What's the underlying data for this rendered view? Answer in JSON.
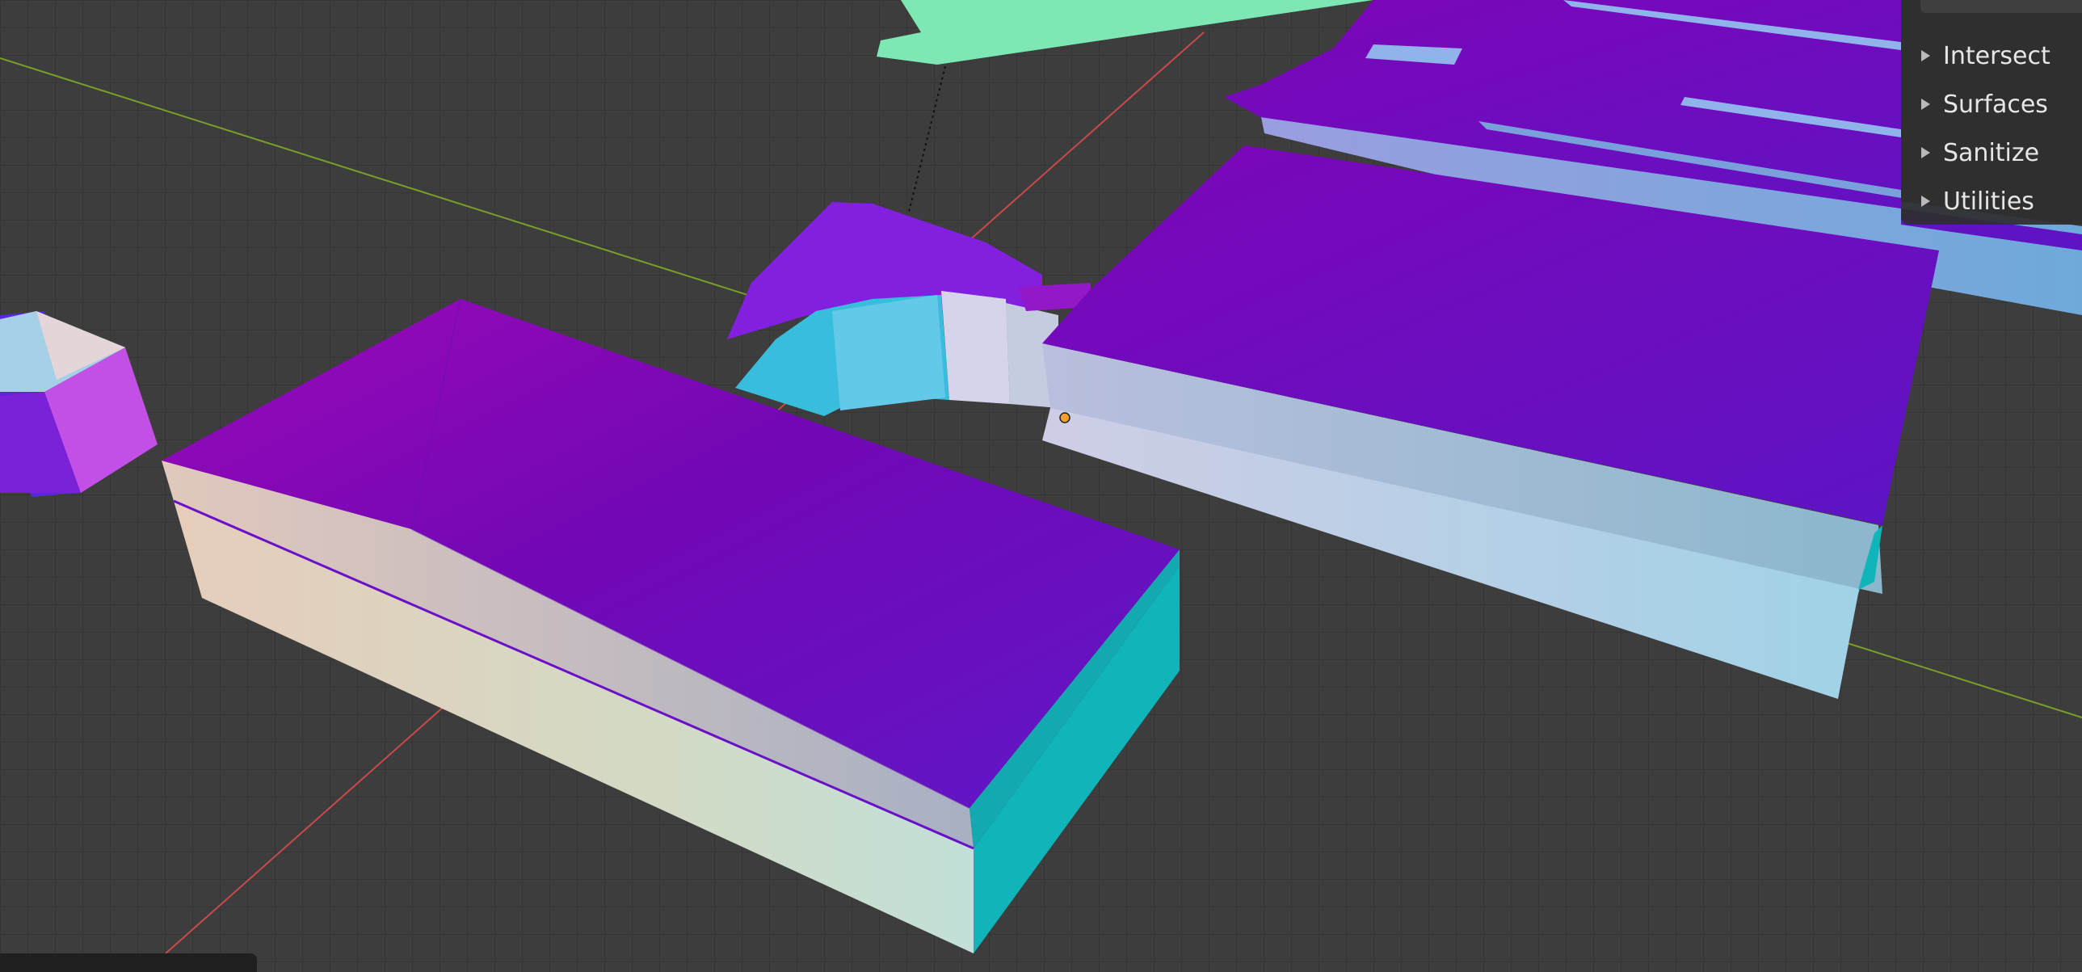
{
  "viewport": {
    "background": "#3d3d3d",
    "grid_color": "#353535",
    "x_axis_color": "#c94a4a",
    "y_axis_color": "#7a9e2a",
    "origin_color": "#f0a030",
    "face_colors": {
      "roof": "#7008b8",
      "wall_light": "#dcd8cc",
      "wall_cyan": "#0fb5b8",
      "wall_blue": "#a9d2e6",
      "green_plane": "#7de8b3"
    }
  },
  "sidebar": {
    "panels": [
      {
        "label": "Intersect",
        "icon": "disclosure-triangle-icon"
      },
      {
        "label": "Surfaces",
        "icon": "disclosure-triangle-icon"
      },
      {
        "label": "Sanitize",
        "icon": "disclosure-triangle-icon"
      },
      {
        "label": "Utilities",
        "icon": "disclosure-triangle-icon"
      }
    ]
  }
}
